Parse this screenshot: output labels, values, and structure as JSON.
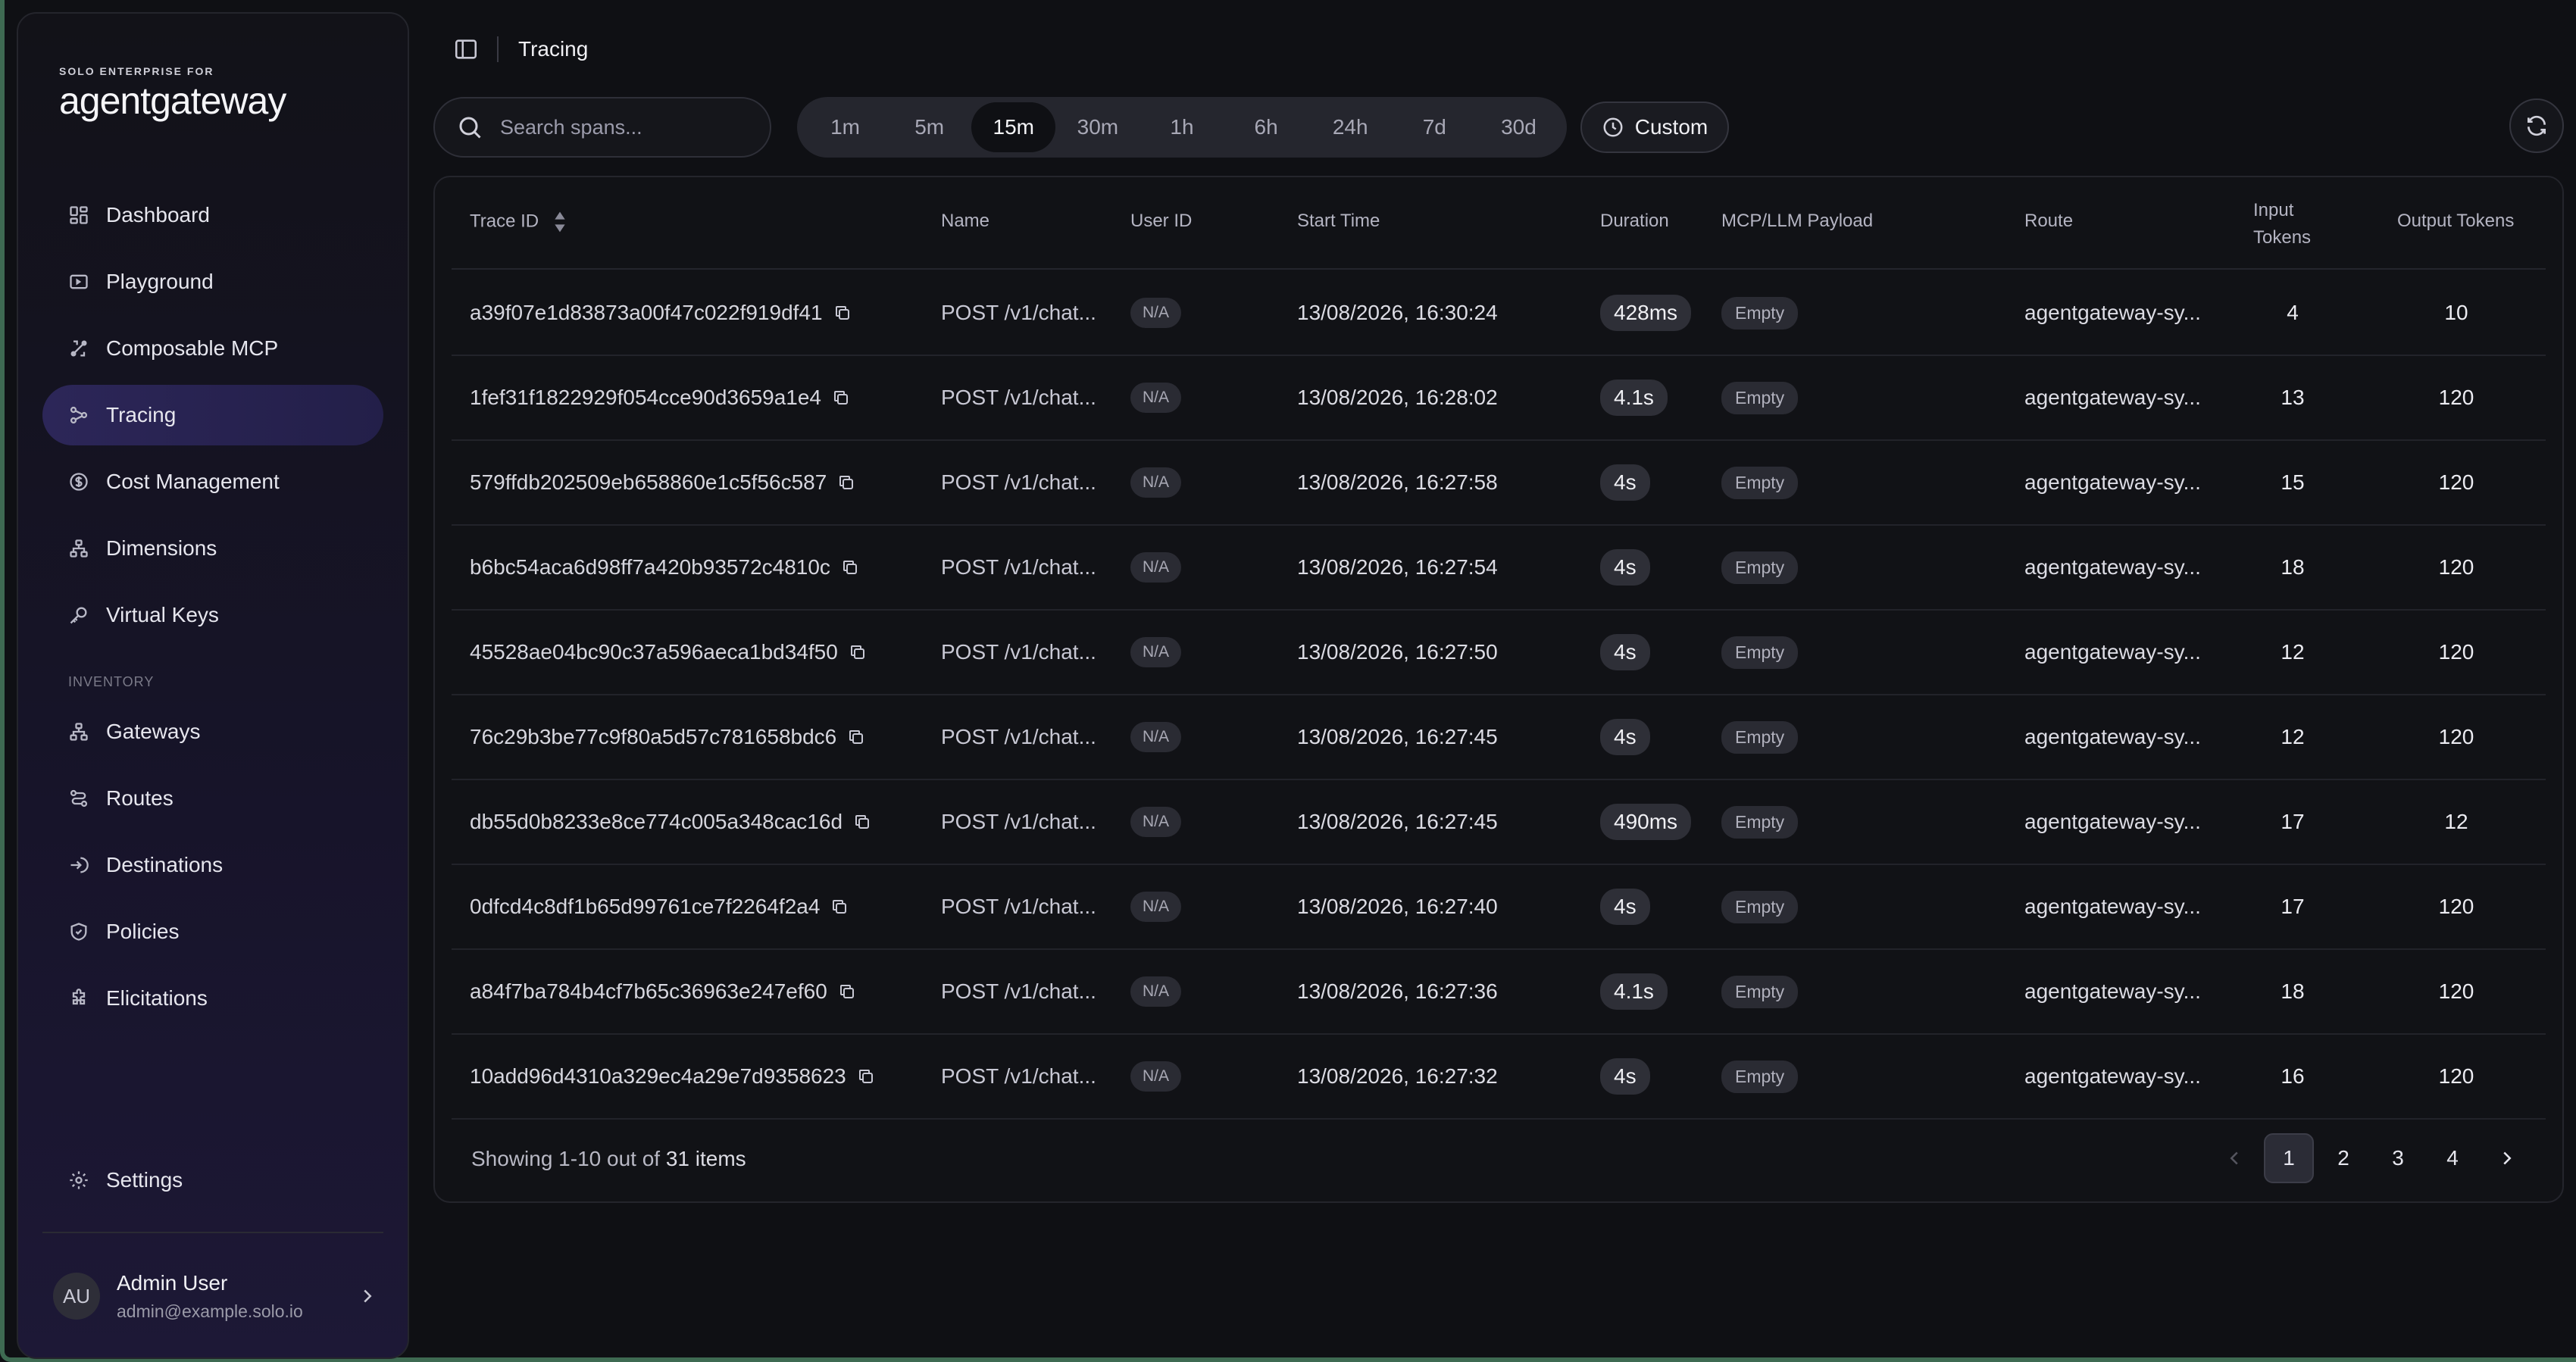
{
  "brand": {
    "top": "SOLO ENTERPRISE FOR",
    "name": "agentgateway"
  },
  "sidebar": {
    "items": [
      {
        "label": "Dashboard",
        "icon": "dashboard-icon"
      },
      {
        "label": "Playground",
        "icon": "playground-icon"
      },
      {
        "label": "Composable MCP",
        "icon": "composable-icon"
      },
      {
        "label": "Tracing",
        "icon": "tracing-icon",
        "active": true
      },
      {
        "label": "Cost Management",
        "icon": "dollar-icon"
      },
      {
        "label": "Dimensions",
        "icon": "hierarchy-icon"
      },
      {
        "label": "Virtual Keys",
        "icon": "key-icon"
      }
    ],
    "section_label": "INVENTORY",
    "inventory": [
      {
        "label": "Gateways",
        "icon": "gateways-icon"
      },
      {
        "label": "Routes",
        "icon": "routes-icon"
      },
      {
        "label": "Destinations",
        "icon": "destinations-icon"
      },
      {
        "label": "Policies",
        "icon": "shield-icon"
      },
      {
        "label": "Elicitations",
        "icon": "puzzle-icon"
      }
    ],
    "settings": {
      "label": "Settings",
      "icon": "gear-icon"
    },
    "user": {
      "initials": "AU",
      "name": "Admin User",
      "email": "admin@example.solo.io"
    }
  },
  "header": {
    "breadcrumb": "Tracing"
  },
  "toolbar": {
    "search_placeholder": "Search spans...",
    "ranges": [
      "1m",
      "5m",
      "15m",
      "30m",
      "1h",
      "6h",
      "24h",
      "7d",
      "30d"
    ],
    "active_range": "15m",
    "custom_label": "Custom"
  },
  "table": {
    "columns": {
      "trace_id": "Trace ID",
      "name": "Name",
      "user_id": "User ID",
      "start_time": "Start Time",
      "duration": "Duration",
      "payload": "MCP/LLM Payload",
      "route": "Route",
      "input_tokens_1": "Input",
      "input_tokens_2": "Tokens",
      "output_tokens": "Output Tokens"
    },
    "rows": [
      {
        "trace_id": "a39f07e1d83873a00f47c022f919df41",
        "name": "POST /v1/chat...",
        "user_id": "N/A",
        "start": "13/08/2026, 16:30:24",
        "duration": "428ms",
        "payload": "Empty",
        "route": "agentgateway-sy...",
        "input": "4",
        "output": "10"
      },
      {
        "trace_id": "1fef31f1822929f054cce90d3659a1e4",
        "name": "POST /v1/chat...",
        "user_id": "N/A",
        "start": "13/08/2026, 16:28:02",
        "duration": "4.1s",
        "payload": "Empty",
        "route": "agentgateway-sy...",
        "input": "13",
        "output": "120"
      },
      {
        "trace_id": "579ffdb202509eb658860e1c5f56c587",
        "name": "POST /v1/chat...",
        "user_id": "N/A",
        "start": "13/08/2026, 16:27:58",
        "duration": "4s",
        "payload": "Empty",
        "route": "agentgateway-sy...",
        "input": "15",
        "output": "120"
      },
      {
        "trace_id": "b6bc54aca6d98ff7a420b93572c4810c",
        "name": "POST /v1/chat...",
        "user_id": "N/A",
        "start": "13/08/2026, 16:27:54",
        "duration": "4s",
        "payload": "Empty",
        "route": "agentgateway-sy...",
        "input": "18",
        "output": "120"
      },
      {
        "trace_id": "45528ae04bc90c37a596aeca1bd34f50",
        "name": "POST /v1/chat...",
        "user_id": "N/A",
        "start": "13/08/2026, 16:27:50",
        "duration": "4s",
        "payload": "Empty",
        "route": "agentgateway-sy...",
        "input": "12",
        "output": "120"
      },
      {
        "trace_id": "76c29b3be77c9f80a5d57c781658bdc6",
        "name": "POST /v1/chat...",
        "user_id": "N/A",
        "start": "13/08/2026, 16:27:45",
        "duration": "4s",
        "payload": "Empty",
        "route": "agentgateway-sy...",
        "input": "12",
        "output": "120"
      },
      {
        "trace_id": "db55d0b8233e8ce774c005a348cac16d",
        "name": "POST /v1/chat...",
        "user_id": "N/A",
        "start": "13/08/2026, 16:27:45",
        "duration": "490ms",
        "payload": "Empty",
        "route": "agentgateway-sy...",
        "input": "17",
        "output": "12"
      },
      {
        "trace_id": "0dfcd4c8df1b65d99761ce7f2264f2a4",
        "name": "POST /v1/chat...",
        "user_id": "N/A",
        "start": "13/08/2026, 16:27:40",
        "duration": "4s",
        "payload": "Empty",
        "route": "agentgateway-sy...",
        "input": "17",
        "output": "120"
      },
      {
        "trace_id": "a84f7ba784b4cf7b65c36963e247ef60",
        "name": "POST /v1/chat...",
        "user_id": "N/A",
        "start": "13/08/2026, 16:27:36",
        "duration": "4.1s",
        "payload": "Empty",
        "route": "agentgateway-sy...",
        "input": "18",
        "output": "120"
      },
      {
        "trace_id": "10add96d4310a329ec4a29e7d9358623",
        "name": "POST /v1/chat...",
        "user_id": "N/A",
        "start": "13/08/2026, 16:27:32",
        "duration": "4s",
        "payload": "Empty",
        "route": "agentgateway-sy...",
        "input": "16",
        "output": "120"
      }
    ],
    "footer": {
      "prefix": "Showing 1-10 out of",
      "total": "31 items"
    },
    "pages": [
      "1",
      "2",
      "3",
      "4"
    ],
    "active_page": "1"
  }
}
